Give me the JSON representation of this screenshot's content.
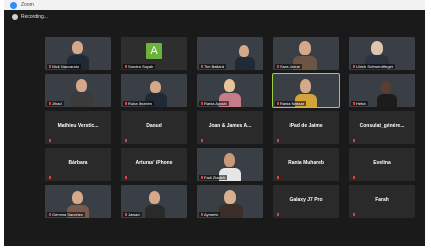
{
  "window": {
    "title": "Zoom",
    "recording_label": "Recording..."
  },
  "tiles": [
    {
      "id": "r1c1",
      "name": "Nick Naccarato",
      "type": "video"
    },
    {
      "id": "r1c2",
      "name": "Sandra Sayah",
      "type": "avatar",
      "initial": "A"
    },
    {
      "id": "r1c3",
      "name": "Tim Ballard",
      "type": "video"
    },
    {
      "id": "r1c4",
      "name": "Sara Jarrar",
      "type": "video"
    },
    {
      "id": "r1c5",
      "name": "Ulrich Schwerdtfeger",
      "type": "video"
    },
    {
      "id": "r2c1",
      "name": "Jihad",
      "type": "video"
    },
    {
      "id": "r2c2",
      "name": "Ruba Ibrahim",
      "type": "video"
    },
    {
      "id": "r2c3",
      "name": "Rania Ayoub",
      "type": "video"
    },
    {
      "id": "r2c4",
      "name": "Rania Nassar",
      "type": "video",
      "active": true
    },
    {
      "id": "r2c5",
      "name": "Heba",
      "type": "video"
    },
    {
      "id": "r3c1",
      "name": "Mathieu Verstic...",
      "type": "name"
    },
    {
      "id": "r3c2",
      "name": "Daoud",
      "type": "name"
    },
    {
      "id": "r3c3",
      "name": "Joan & James A...",
      "type": "name"
    },
    {
      "id": "r3c4",
      "name": "iPad de Jaime",
      "type": "name"
    },
    {
      "id": "r3c5",
      "name": "Consulat_génére...",
      "type": "name"
    },
    {
      "id": "r4c1",
      "name": "Bárbara",
      "type": "name"
    },
    {
      "id": "r4c2",
      "name": "Arturas' iPhone",
      "type": "name"
    },
    {
      "id": "r4c3",
      "name": "Fadi Ziadeh",
      "type": "video"
    },
    {
      "id": "r4c4",
      "name": "Rania Muhareb",
      "type": "name"
    },
    {
      "id": "r4c5",
      "name": "Evelina",
      "type": "name"
    },
    {
      "id": "r5c1",
      "name": "Gemma Sanchez",
      "type": "video"
    },
    {
      "id": "r5c2",
      "name": "Jawad",
      "type": "video"
    },
    {
      "id": "r5c3",
      "name": "Aymeric",
      "type": "video"
    },
    {
      "id": "r5c4",
      "name": "Galaxy J7 Pro",
      "type": "name"
    },
    {
      "id": "r5c5",
      "name": "Farah",
      "type": "name"
    }
  ]
}
